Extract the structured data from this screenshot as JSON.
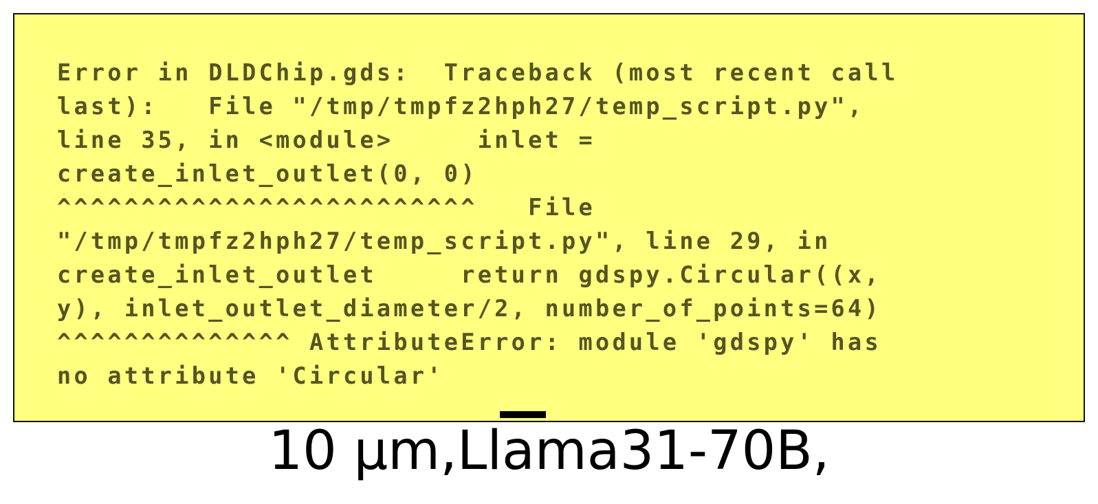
{
  "error_panel": {
    "background_color": "#ffff80",
    "text_color": "#555522",
    "lines": [
      "Error in DLDChip.gds:  Traceback (most recent call",
      "last):   File \"/tmp/tmpfz2hph27/temp_script.py\",",
      "line 35, in <module>     inlet =",
      "create_inlet_outlet(0, 0)",
      "^^^^^^^^^^^^^^^^^^^^^^^^^   File",
      "\"/tmp/tmpfz2hph27/temp_script.py\", line 29, in",
      "create_inlet_outlet     return gdspy.Circular((x,",
      "y), inlet_outlet_diameter/2, number_of_points=64)",
      "^^^^^^^^^^^^^^ AttributeError: module 'gdspy' has",
      "no attribute 'Circular'"
    ]
  },
  "caption": {
    "text": "10 µm,Llama31-70B,"
  }
}
